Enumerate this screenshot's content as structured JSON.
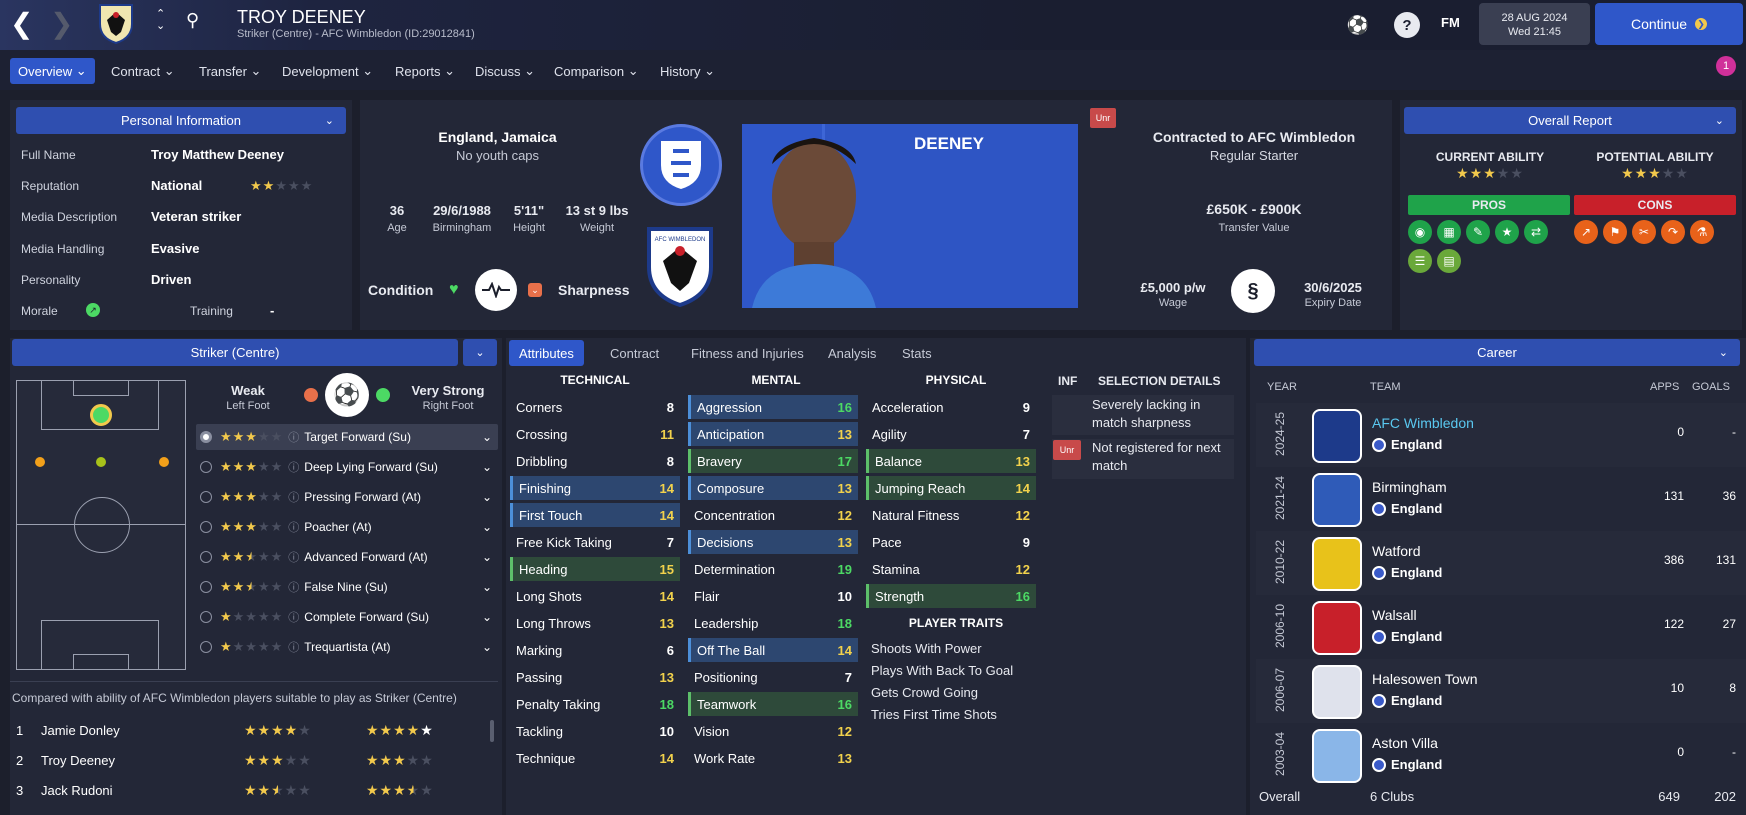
{
  "header": {
    "player_name": "TROY DEENEY",
    "subtitle": "Striker (Centre) - AFC Wimbledon (ID:29012841)",
    "date": "28 AUG 2024",
    "time": "Wed 21:45",
    "fm_label": "FM",
    "continue_label": "Continue",
    "help": "?"
  },
  "menu": [
    {
      "label": "Overview"
    },
    {
      "label": "Contract"
    },
    {
      "label": "Transfer"
    },
    {
      "label": "Development"
    },
    {
      "label": "Reports"
    },
    {
      "label": "Discuss"
    },
    {
      "label": "Comparison"
    },
    {
      "label": "History"
    }
  ],
  "notification_count": "1",
  "personal": {
    "title": "Personal Information",
    "rows": [
      {
        "label": "Full Name",
        "value": "Troy Matthew Deeney"
      },
      {
        "label": "Reputation",
        "value": "National"
      },
      {
        "label": "Media Description",
        "value": "Veteran striker"
      },
      {
        "label": "Media Handling",
        "value": "Evasive"
      },
      {
        "label": "Personality",
        "value": "Driven"
      }
    ],
    "morale_label": "Morale",
    "training_label": "Training",
    "training_value": "-",
    "reputation_stars": 2
  },
  "bio": {
    "nationality": "England, Jamaica",
    "youth_caps": "No youth caps",
    "stats": [
      {
        "value": "36",
        "label": "Age"
      },
      {
        "value": "29/6/1988",
        "label": "Birmingham"
      },
      {
        "value": "5'11\"",
        "label": "Height"
      },
      {
        "value": "13 st 9 lbs",
        "label": "Weight"
      }
    ],
    "condition_label": "Condition",
    "sharpness_label": "Sharpness",
    "shirt_name": "DEENEY",
    "unr_tag": "Unr"
  },
  "contract": {
    "title": "Contracted to AFC Wimbledon",
    "status": "Regular Starter",
    "value": "£650K - £900K",
    "value_label": "Transfer Value",
    "wage": "£5,000 p/w",
    "wage_label": "Wage",
    "expiry": "30/6/2025",
    "expiry_label": "Expiry Date"
  },
  "report": {
    "title": "Overall Report",
    "current_label": "CURRENT ABILITY",
    "potential_label": "POTENTIAL ABILITY",
    "current_stars": 3,
    "potential_stars": 3,
    "pros_label": "PROS",
    "cons_label": "CONS"
  },
  "position": {
    "title": "Striker (Centre)",
    "weak_label": "Weak",
    "weak_sub": "Left Foot",
    "strong_label": "Very Strong",
    "strong_sub": "Right Foot",
    "roles": [
      {
        "name": "Target Forward (Su)",
        "stars": 3,
        "half": false,
        "selected": true
      },
      {
        "name": "Deep Lying Forward (Su)",
        "stars": 3,
        "half": false
      },
      {
        "name": "Pressing Forward (At)",
        "stars": 3,
        "half": false
      },
      {
        "name": "Poacher (At)",
        "stars": 3,
        "half": false
      },
      {
        "name": "Advanced Forward (At)",
        "stars": 2,
        "half": true
      },
      {
        "name": "False Nine (Su)",
        "stars": 2,
        "half": true
      },
      {
        "name": "Complete Forward (Su)",
        "stars": 1,
        "half": false
      },
      {
        "name": "Trequartista (At)",
        "stars": 1,
        "half": false
      }
    ],
    "compare_text": "Compared with ability of AFC Wimbledon players suitable to play as Striker (Centre)",
    "compare": [
      {
        "rank": "1",
        "name": "Jamie Donley",
        "ca": 4,
        "pa": 5
      },
      {
        "rank": "2",
        "name": "Troy Deeney",
        "ca": 3,
        "pa": 3
      },
      {
        "rank": "3",
        "name": "Jack Rudoni",
        "ca": 2.5,
        "pa": 3.5
      }
    ]
  },
  "tabs": [
    {
      "label": "Attributes"
    },
    {
      "label": "Contract"
    },
    {
      "label": "Fitness and Injuries"
    },
    {
      "label": "Analysis"
    },
    {
      "label": "Stats"
    }
  ],
  "attributes": {
    "technical_title": "TECHNICAL",
    "mental_title": "MENTAL",
    "physical_title": "PHYSICAL",
    "technical": [
      {
        "name": "Corners",
        "value": "8",
        "c": "w"
      },
      {
        "name": "Crossing",
        "value": "11",
        "c": "y"
      },
      {
        "name": "Dribbling",
        "value": "8",
        "c": "w"
      },
      {
        "name": "Finishing",
        "value": "14",
        "c": "y",
        "hl": "b"
      },
      {
        "name": "First Touch",
        "value": "14",
        "c": "y",
        "hl": "b"
      },
      {
        "name": "Free Kick Taking",
        "value": "7",
        "c": "w"
      },
      {
        "name": "Heading",
        "value": "15",
        "c": "y",
        "hl": "g"
      },
      {
        "name": "Long Shots",
        "value": "14",
        "c": "y"
      },
      {
        "name": "Long Throws",
        "value": "13",
        "c": "y"
      },
      {
        "name": "Marking",
        "value": "6",
        "c": "w"
      },
      {
        "name": "Passing",
        "value": "13",
        "c": "y"
      },
      {
        "name": "Penalty Taking",
        "value": "18",
        "c": "g"
      },
      {
        "name": "Tackling",
        "value": "10",
        "c": "w"
      },
      {
        "name": "Technique",
        "value": "14",
        "c": "y"
      }
    ],
    "mental": [
      {
        "name": "Aggression",
        "value": "16",
        "c": "g",
        "hl": "b"
      },
      {
        "name": "Anticipation",
        "value": "13",
        "c": "y",
        "hl": "b"
      },
      {
        "name": "Bravery",
        "value": "17",
        "c": "g",
        "hl": "g"
      },
      {
        "name": "Composure",
        "value": "13",
        "c": "y",
        "hl": "b"
      },
      {
        "name": "Concentration",
        "value": "12",
        "c": "y"
      },
      {
        "name": "Decisions",
        "value": "13",
        "c": "y",
        "hl": "b"
      },
      {
        "name": "Determination",
        "value": "19",
        "c": "g"
      },
      {
        "name": "Flair",
        "value": "10",
        "c": "w"
      },
      {
        "name": "Leadership",
        "value": "18",
        "c": "g"
      },
      {
        "name": "Off The Ball",
        "value": "14",
        "c": "y",
        "hl": "b"
      },
      {
        "name": "Positioning",
        "value": "7",
        "c": "w"
      },
      {
        "name": "Teamwork",
        "value": "16",
        "c": "g",
        "hl": "g"
      },
      {
        "name": "Vision",
        "value": "12",
        "c": "y"
      },
      {
        "name": "Work Rate",
        "value": "13",
        "c": "y"
      }
    ],
    "physical": [
      {
        "name": "Acceleration",
        "value": "9",
        "c": "w"
      },
      {
        "name": "Agility",
        "value": "7",
        "c": "w"
      },
      {
        "name": "Balance",
        "value": "13",
        "c": "y",
        "hl": "g"
      },
      {
        "name": "Jumping Reach",
        "value": "14",
        "c": "y",
        "hl": "g"
      },
      {
        "name": "Natural Fitness",
        "value": "12",
        "c": "y"
      },
      {
        "name": "Pace",
        "value": "9",
        "c": "w"
      },
      {
        "name": "Stamina",
        "value": "12",
        "c": "y"
      },
      {
        "name": "Strength",
        "value": "16",
        "c": "g",
        "hl": "g"
      }
    ],
    "traits_title": "PLAYER TRAITS",
    "traits": [
      "Shoots With Power",
      "Plays With Back To Goal",
      "Gets Crowd Going",
      "Tries First Time Shots"
    ]
  },
  "selection": {
    "inf_label": "INF",
    "title": "SELECTION DETAILS",
    "items": [
      {
        "tag": "",
        "text": "Severely lacking in match sharpness"
      },
      {
        "tag": "Unr",
        "text": "Not registered for next match"
      }
    ]
  },
  "career": {
    "title": "Career",
    "year_hdr": "YEAR",
    "team_hdr": "TEAM",
    "apps_hdr": "APPS",
    "goals_hdr": "GOALS",
    "rows": [
      {
        "year": "2024-25",
        "team": "AFC Wimbledon",
        "nation": "England",
        "apps": "0",
        "goals": "-",
        "color": "#1d3a8a",
        "current": true
      },
      {
        "year": "2021-24",
        "team": "Birmingham",
        "nation": "England",
        "apps": "131",
        "goals": "36",
        "color": "#2f5bb8"
      },
      {
        "year": "2010-22",
        "team": "Watford",
        "nation": "England",
        "apps": "386",
        "goals": "131",
        "color": "#e8c21a"
      },
      {
        "year": "2006-10",
        "team": "Walsall",
        "nation": "England",
        "apps": "122",
        "goals": "27",
        "color": "#c8202a"
      },
      {
        "year": "2006-07",
        "team": "Halesowen Town",
        "nation": "England",
        "apps": "10",
        "goals": "8",
        "color": "#dfe2ec"
      },
      {
        "year": "2003-04",
        "team": "Aston Villa",
        "nation": "England",
        "apps": "0",
        "goals": "-",
        "color": "#8ab6e8"
      }
    ],
    "overall_label": "Overall",
    "overall_clubs": "6 Clubs",
    "overall_apps": "649",
    "overall_goals": "202"
  },
  "colors": {
    "accent": "#2f57c9",
    "yellow": "#f2d24c",
    "green": "#4cd964",
    "pros": "#1fa34a",
    "cons": "#c8202a"
  }
}
